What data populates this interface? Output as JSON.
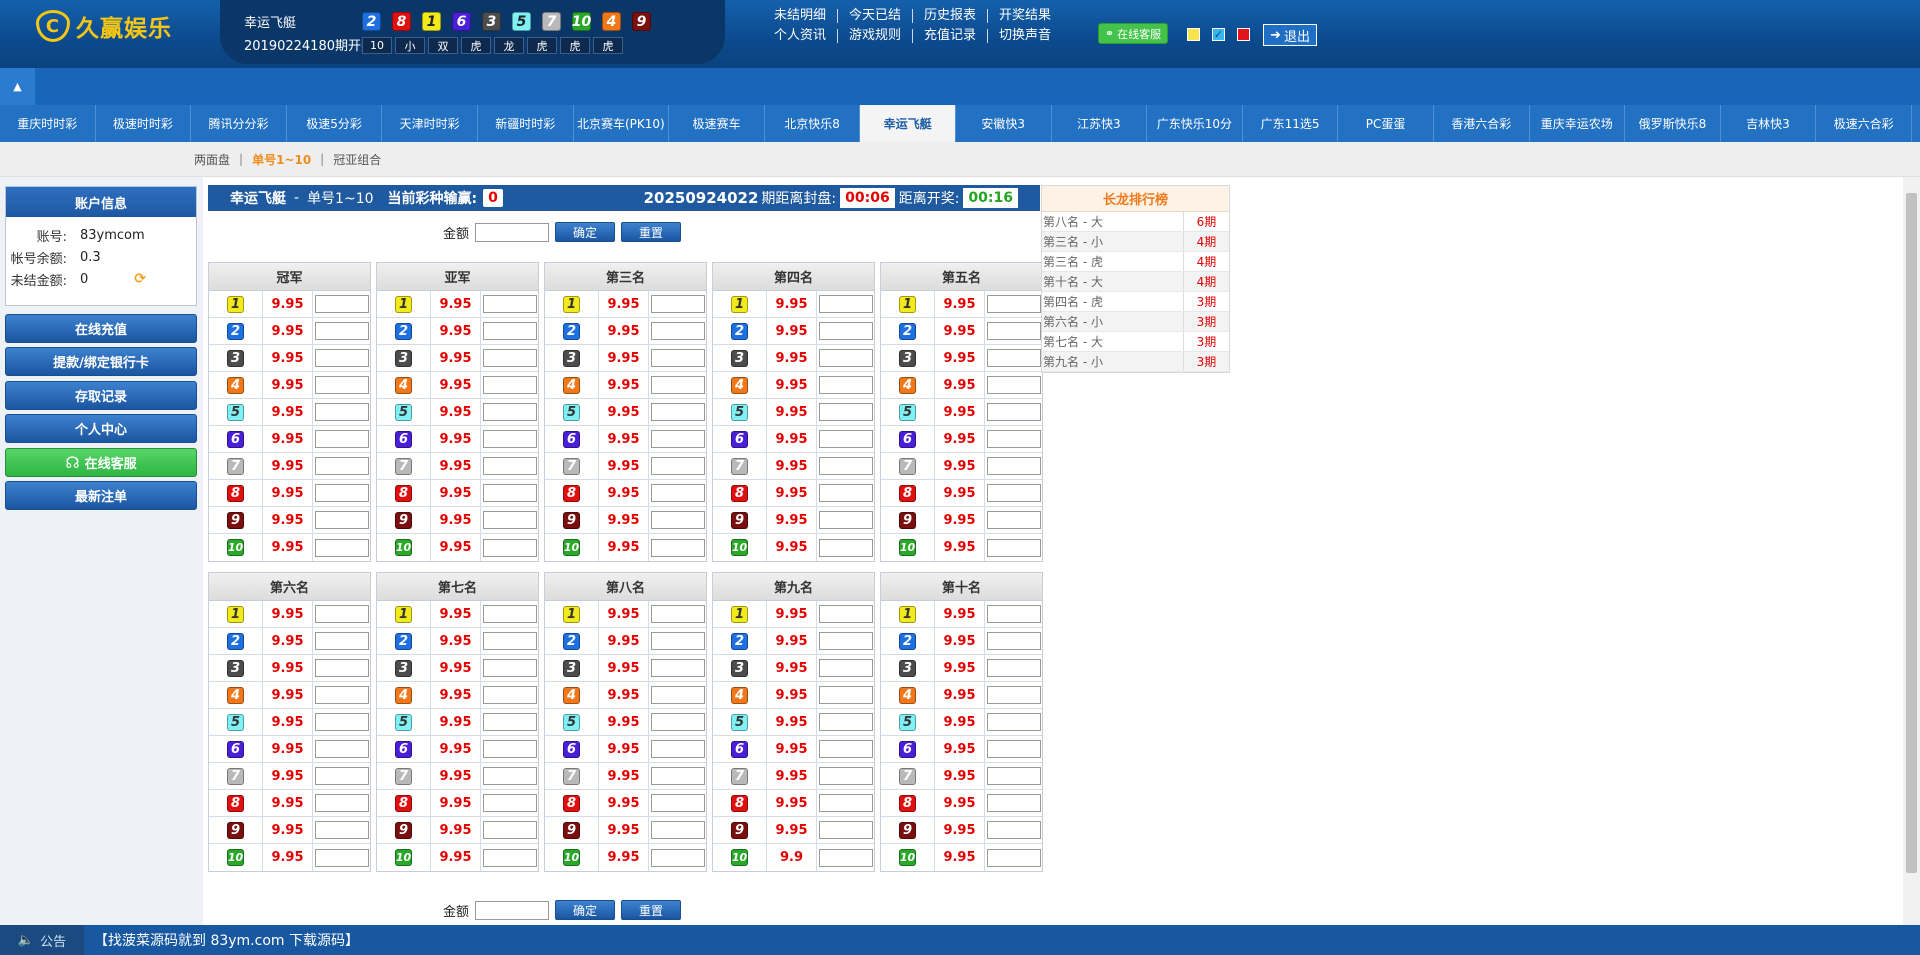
{
  "brand": {
    "name": "久赢娱乐",
    "mark": "C"
  },
  "draw": {
    "game": "幸运飞艇",
    "issue": "20190224180期开奖",
    "balls": [
      {
        "n": "2",
        "color": "#1e6fe0"
      },
      {
        "n": "8",
        "color": "#e01010"
      },
      {
        "n": "1",
        "color": "#f3ea1c"
      },
      {
        "n": "6",
        "color": "#4a1fd8"
      },
      {
        "n": "3",
        "color": "#4c4c4c"
      },
      {
        "n": "5",
        "color": "#7ff0f4"
      },
      {
        "n": "7",
        "color": "#b9b9b9"
      },
      {
        "n": "10",
        "color": "#2aa82a"
      },
      {
        "n": "4",
        "color": "#f0781a"
      },
      {
        "n": "9",
        "color": "#7a0f0f"
      }
    ],
    "stats": [
      "10",
      "小",
      "双",
      "虎",
      "龙",
      "虎",
      "虎",
      "虎"
    ]
  },
  "toplinks": [
    "未结明细",
    "今天已结",
    "历史报表",
    "开奖结果",
    "个人资讯",
    "游戏规则",
    "充值记录",
    "切换声音"
  ],
  "online_service_label": "在线客服",
  "logout_label": "退出",
  "sound_colors": [
    "#f9e34b",
    "#35b7ef",
    "#e2141b"
  ],
  "game_tabs": [
    "重庆时时彩",
    "极速时时彩",
    "腾讯分分彩",
    "极速5分彩",
    "天津时时彩",
    "新疆时时彩",
    "北京赛车(PK10)",
    "极速赛车",
    "北京快乐8",
    "幸运飞艇",
    "安徽快3",
    "江苏快3",
    "广东快乐10分",
    "广东11选5",
    "PC蛋蛋",
    "香港六合彩",
    "重庆幸运农场",
    "俄罗斯快乐8",
    "吉林快3",
    "极速六合彩"
  ],
  "active_tab_index": 9,
  "subnav": [
    "两面盘",
    "单号1~10",
    "冠亚组合"
  ],
  "subnav_current": 1,
  "account": {
    "title": "账户信息",
    "rows": [
      {
        "k": "账号:",
        "v": "83ymcom"
      },
      {
        "k": "帐号余额:",
        "v": "0.3"
      },
      {
        "k": "未结金额:",
        "v": "0"
      }
    ]
  },
  "side_buttons": [
    "在线充值",
    "提款/绑定银行卡",
    "存取记录",
    "个人中心",
    "在线客服",
    "最新注单"
  ],
  "infobar": {
    "game": "幸运飞艇",
    "dash": "-",
    "sub": "单号1~10",
    "pl_label": "当前彩种输赢:",
    "pl_value": "0",
    "period": "20250924022",
    "close_label": "期距离封盘:",
    "close_time": "00:06",
    "open_label": "距离开奖:",
    "open_time": "00:16"
  },
  "amount_label": "金额",
  "confirm_label": "确定",
  "reset_label": "重置",
  "positions": [
    "冠军",
    "亚军",
    "第三名",
    "第四名",
    "第五名",
    "第六名",
    "第七名",
    "第八名",
    "第九名",
    "第十名"
  ],
  "odds": [
    [
      "9.95",
      "9.95",
      "9.95",
      "9.95",
      "9.95",
      "9.95",
      "9.95",
      "9.95",
      "9.95",
      "9.95"
    ],
    [
      "9.95",
      "9.95",
      "9.95",
      "9.95",
      "9.95",
      "9.95",
      "9.95",
      "9.95",
      "9.95",
      "9.95"
    ],
    [
      "9.95",
      "9.95",
      "9.95",
      "9.95",
      "9.95",
      "9.95",
      "9.95",
      "9.95",
      "9.95",
      "9.95"
    ],
    [
      "9.95",
      "9.95",
      "9.95",
      "9.95",
      "9.95",
      "9.95",
      "9.95",
      "9.95",
      "9.95",
      "9.95"
    ],
    [
      "9.95",
      "9.95",
      "9.95",
      "9.95",
      "9.95",
      "9.95",
      "9.95",
      "9.95",
      "9.95",
      "9.95"
    ],
    [
      "9.95",
      "9.95",
      "9.95",
      "9.95",
      "9.95",
      "9.95",
      "9.95",
      "9.95",
      "9.95",
      "9.95"
    ],
    [
      "9.95",
      "9.95",
      "9.95",
      "9.95",
      "9.95",
      "9.95",
      "9.95",
      "9.95",
      "9.95",
      "9.95"
    ],
    [
      "9.95",
      "9.95",
      "9.95",
      "9.95",
      "9.95",
      "9.95",
      "9.95",
      "9.95",
      "9.95",
      "9.95"
    ],
    [
      "9.95",
      "9.95",
      "9.95",
      "9.95",
      "9.95",
      "9.95",
      "9.95",
      "9.95",
      "9.95",
      "9.9"
    ],
    [
      "9.95",
      "9.95",
      "9.95",
      "9.95",
      "9.95",
      "9.95",
      "9.95",
      "9.95",
      "9.95",
      "9.95"
    ]
  ],
  "ball_colors": [
    "#f3ea1c",
    "#1e6fe0",
    "#4c4c4c",
    "#f0781a",
    "#7ff0f4",
    "#4a1fd8",
    "#b9b9b9",
    "#e01010",
    "#7a0f0f",
    "#2aa82a"
  ],
  "ball_text_colors": [
    "#333",
    "#fff",
    "#fff",
    "#fff",
    "#333",
    "#fff",
    "#fff",
    "#fff",
    "#fff",
    "#fff"
  ],
  "dragon": {
    "title": "长龙排行榜",
    "rows": [
      {
        "a": "第八名 - 大",
        "b": "6期"
      },
      {
        "a": "第三名 - 小",
        "b": "4期"
      },
      {
        "a": "第三名 - 虎",
        "b": "4期"
      },
      {
        "a": "第十名 - 大",
        "b": "4期"
      },
      {
        "a": "第四名 - 虎",
        "b": "3期"
      },
      {
        "a": "第六名 - 小",
        "b": "3期"
      },
      {
        "a": "第七名 - 大",
        "b": "3期"
      },
      {
        "a": "第九名 - 小",
        "b": "3期"
      }
    ]
  },
  "footer": {
    "notice_label": "公告",
    "message": "【找菠菜源码就到 83ym.com 下载源码】"
  }
}
